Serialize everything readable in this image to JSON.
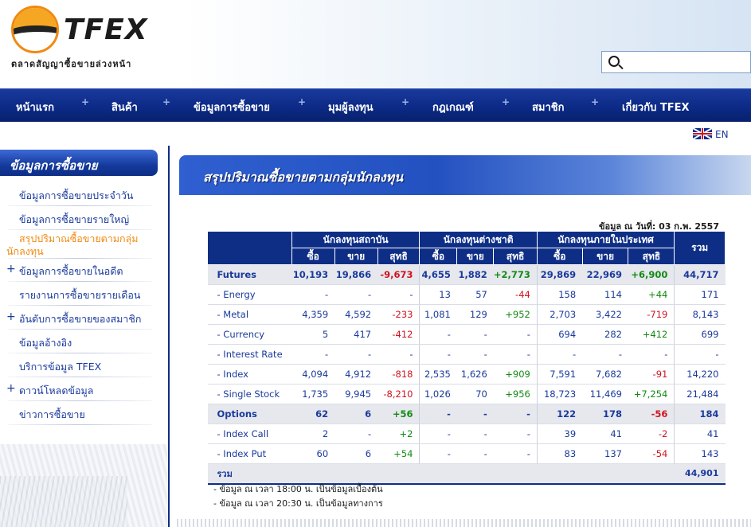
{
  "header": {
    "logo_text": "TFEX",
    "logo_subtitle": "ตลาดสัญญาซื้อขายล่วงหน้า",
    "search": {
      "placeholder": ""
    }
  },
  "nav": {
    "items": [
      "หน้าแรก",
      "สินค้า",
      "ข้อมูลการซื้อขาย",
      "มุมผู้ลงทุน",
      "กฎเกณฑ์",
      "สมาชิก",
      "เกี่ยวกับ TFEX"
    ],
    "separator": "+"
  },
  "lang": {
    "label": "EN",
    "flag_icon": "uk-flag-icon"
  },
  "sidebar": {
    "title": "ข้อมูลการซื้อขาย",
    "items": [
      {
        "label": "ข้อมูลการซื้อขายประจำวัน",
        "expand": ""
      },
      {
        "label": "ข้อมูลการซื้อขายรายใหญ่",
        "expand": ""
      },
      {
        "label": "สรุปปริมาณซื้อขายตามกลุ่ม",
        "label2": "นักลงทุน",
        "expand": "",
        "active": true
      },
      {
        "label": "ข้อมูลการซื้อขายในอดีต",
        "expand": "+"
      },
      {
        "label": "รายงานการซื้อขายรายเดือน",
        "expand": ""
      },
      {
        "label": "อันดับการซื้อขายของสมาชิก",
        "expand": "+"
      },
      {
        "label": "ข้อมูลอ้างอิง",
        "expand": ""
      },
      {
        "label": "บริการข้อมูล TFEX",
        "expand": ""
      },
      {
        "label": "ดาวน์โหลดข้อมูล",
        "expand": "+"
      },
      {
        "label": "ข่าวการซื้อขาย",
        "expand": ""
      }
    ]
  },
  "main": {
    "title": "สรุปปริมาณซื้อขายตามกลุ่มนักลงทุน",
    "data_date": "ข้อมูล ณ วันที่: 03 ก.พ. 2557",
    "table": {
      "groups": [
        "นักลงทุนสถาบัน",
        "นักลงทุนต่างชาติ",
        "นักลงทุนภายในประเทศ",
        "รวม"
      ],
      "subheaders": [
        "ซื้อ",
        "ขาย",
        "สุทธิ",
        "ซื้อ",
        "ขาย",
        "สุทธิ",
        "ซื้อ",
        "ขาย",
        "สุทธิ"
      ],
      "rows": [
        {
          "name": "Futures",
          "type": "group",
          "cells": [
            "10,193",
            "19,866",
            "-9,673",
            "4,655",
            "1,882",
            "+2,773",
            "29,869",
            "22,969",
            "+6,900",
            "44,717"
          ]
        },
        {
          "name": "- Energy",
          "type": "item",
          "cells": [
            "-",
            "-",
            "-",
            "13",
            "57",
            "-44",
            "158",
            "114",
            "+44",
            "171"
          ]
        },
        {
          "name": "- Metal",
          "type": "item",
          "cells": [
            "4,359",
            "4,592",
            "-233",
            "1,081",
            "129",
            "+952",
            "2,703",
            "3,422",
            "-719",
            "8,143"
          ]
        },
        {
          "name": "- Currency",
          "type": "item",
          "cells": [
            "5",
            "417",
            "-412",
            "-",
            "-",
            "-",
            "694",
            "282",
            "+412",
            "699"
          ]
        },
        {
          "name": "- Interest Rate",
          "type": "item",
          "cells": [
            "-",
            "-",
            "-",
            "-",
            "-",
            "-",
            "-",
            "-",
            "-",
            "-"
          ]
        },
        {
          "name": "- Index",
          "type": "item",
          "cells": [
            "4,094",
            "4,912",
            "-818",
            "2,535",
            "1,626",
            "+909",
            "7,591",
            "7,682",
            "-91",
            "14,220"
          ]
        },
        {
          "name": "- Single Stock",
          "type": "item",
          "cells": [
            "1,735",
            "9,945",
            "-8,210",
            "1,026",
            "70",
            "+956",
            "18,723",
            "11,469",
            "+7,254",
            "21,484"
          ]
        },
        {
          "name": "Options",
          "type": "group",
          "cells": [
            "62",
            "6",
            "+56",
            "-",
            "-",
            "-",
            "122",
            "178",
            "-56",
            "184"
          ]
        },
        {
          "name": "- Index Call",
          "type": "item",
          "cells": [
            "2",
            "-",
            "+2",
            "-",
            "-",
            "-",
            "39",
            "41",
            "-2",
            "41"
          ]
        },
        {
          "name": "- Index Put",
          "type": "item",
          "cells": [
            "60",
            "6",
            "+54",
            "-",
            "-",
            "-",
            "83",
            "137",
            "-54",
            "143"
          ]
        }
      ],
      "total": {
        "label": "รวม",
        "value": "44,901"
      }
    },
    "notes": [
      "- ข้อมูล ณ เวลา 18:00 น. เป็นข้อมูลเบื้องต้น",
      "- ข้อมูล ณ เวลา 20:30 น. เป็นข้อมูลทางการ"
    ]
  },
  "colors": {
    "nav_bg": "#0e2e86",
    "accent_orange": "#f08a12",
    "negative": "#d0141f",
    "positive": "#138a13"
  }
}
